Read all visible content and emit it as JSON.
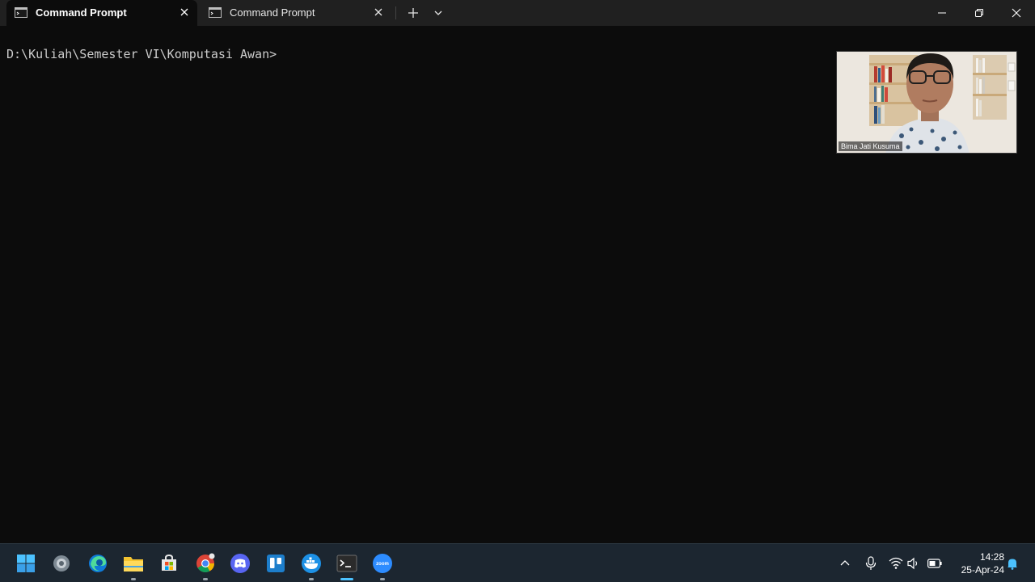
{
  "tabs": [
    {
      "title": "Command Prompt",
      "active": true
    },
    {
      "title": "Command Prompt",
      "active": false
    }
  ],
  "terminal": {
    "prompt": "D:\\Kuliah\\Semester VI\\Komputasi Awan>"
  },
  "webcam": {
    "participant_name": "Bima Jati Kusuma"
  },
  "taskbar": {
    "apps": [
      "start-icon",
      "settings-icon",
      "edge-icon",
      "file-explorer-icon",
      "microsoft-store-icon",
      "chrome-icon",
      "discord-icon",
      "trello-icon",
      "docker-icon",
      "terminal-icon",
      "zoom-icon"
    ],
    "zoom_label": "zoom"
  },
  "clock": {
    "time": "14:28",
    "date": "25-Apr-24"
  },
  "colors": {
    "terminal_bg": "#0c0c0c",
    "titlebar_bg": "#202020",
    "taskbar_bg": "#1c2630",
    "accent": "#4cc2ff"
  }
}
